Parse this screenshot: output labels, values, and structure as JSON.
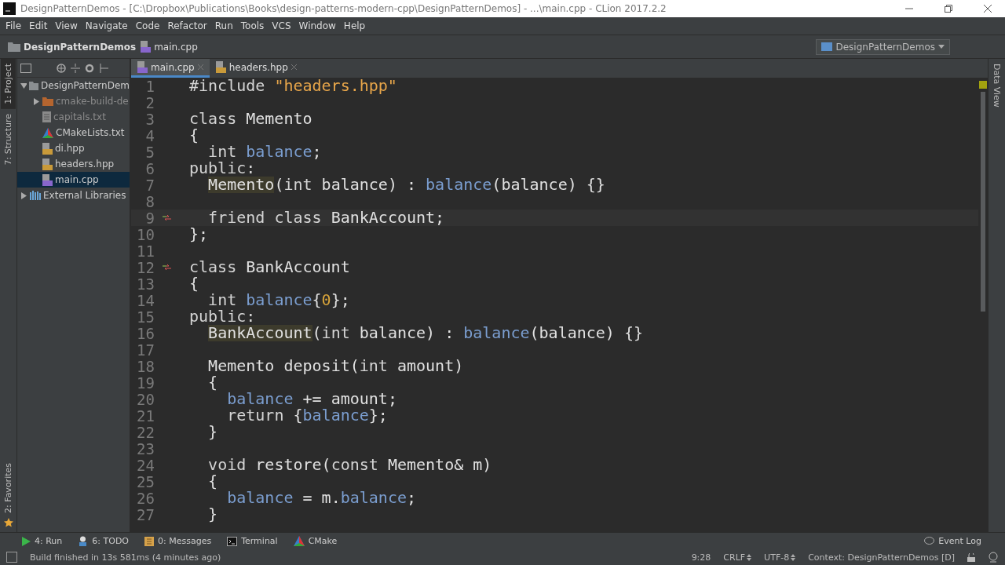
{
  "window": {
    "title": "DesignPatternDemos - [C:\\Dropbox\\Publications\\Books\\design-patterns-modern-cpp\\DesignPatternDemos] - ...\\main.cpp - CLion 2017.2.2"
  },
  "menu": [
    "File",
    "Edit",
    "View",
    "Navigate",
    "Code",
    "Refactor",
    "Run",
    "Tools",
    "VCS",
    "Window",
    "Help"
  ],
  "breadcrumbs": [
    "DesignPatternDemos",
    "main.cpp"
  ],
  "run_config": "DesignPatternDemos",
  "left_stripe": [
    {
      "label": "1: Project",
      "selected": true
    },
    {
      "label": "7: Structure",
      "selected": false
    }
  ],
  "favorites": "2: Favorites",
  "right_stripe": "Data View",
  "tree": [
    {
      "label": "DesignPatternDem",
      "kind": "project",
      "expanded": true,
      "selected": false,
      "children": [
        {
          "label": "cmake-build-de",
          "kind": "folder",
          "expanded": false,
          "selected": false
        },
        {
          "label": "capitals.txt",
          "kind": "text",
          "selected": false
        },
        {
          "label": "CMakeLists.txt",
          "kind": "cmake",
          "selected": false
        },
        {
          "label": "di.hpp",
          "kind": "header",
          "selected": false
        },
        {
          "label": "headers.hpp",
          "kind": "header",
          "selected": false
        },
        {
          "label": "main.cpp",
          "kind": "source",
          "selected": true
        }
      ]
    },
    {
      "label": "External Libraries",
      "kind": "library",
      "expanded": false,
      "selected": false
    }
  ],
  "tabs": [
    {
      "label": "main.cpp",
      "kind": "source",
      "selected": true
    },
    {
      "label": "headers.hpp",
      "kind": "header",
      "selected": false
    }
  ],
  "code": [
    {
      "num": "1",
      "current": false,
      "override": false,
      "tokens": [
        {
          "t": "#include ",
          "kind": "kw"
        },
        {
          "t": "\"headers.hpp\"",
          "kind": "str"
        }
      ]
    },
    {
      "num": "2",
      "current": false,
      "override": false
    },
    {
      "num": "3",
      "current": false,
      "override": false,
      "tokens": [
        {
          "t": "class ",
          "kind": "kw"
        },
        {
          "t": "Memento",
          "kind": "plain"
        }
      ]
    },
    {
      "num": "4",
      "current": false,
      "override": false,
      "tokens": [
        {
          "t": "{",
          "kind": "plain"
        }
      ]
    },
    {
      "num": "5",
      "current": false,
      "override": false,
      "tokens": [
        {
          "t": "  int ",
          "kind": "kw"
        },
        {
          "t": "balance",
          "kind": "field"
        },
        {
          "t": ";",
          "kind": "plain"
        }
      ]
    },
    {
      "num": "6",
      "current": false,
      "override": false,
      "tokens": [
        {
          "t": "public:",
          "kind": "kw"
        }
      ]
    },
    {
      "num": "7",
      "current": false,
      "override": false,
      "tokens": [
        {
          "t": "  Memento",
          "kind": "decl"
        },
        {
          "t": "(",
          "kind": "plain"
        },
        {
          "t": "int ",
          "kind": "kw"
        },
        {
          "t": "balance) : ",
          "kind": "plain"
        },
        {
          "t": "balance",
          "kind": "field"
        },
        {
          "t": "(balance) {}",
          "kind": "plain"
        }
      ]
    },
    {
      "num": "8",
      "current": false,
      "override": false
    },
    {
      "num": "9",
      "current": true,
      "override": true,
      "tokens": [
        {
          "t": "  friend class ",
          "kind": "kw"
        },
        {
          "t": "BankAccount;",
          "kind": "plain"
        }
      ]
    },
    {
      "num": "10",
      "current": false,
      "override": false,
      "tokens": [
        {
          "t": "};",
          "kind": "plain"
        }
      ]
    },
    {
      "num": "11",
      "current": false,
      "override": false
    },
    {
      "num": "12",
      "current": false,
      "override": true,
      "tokens": [
        {
          "t": "class ",
          "kind": "kw"
        },
        {
          "t": "BankAccount",
          "kind": "plain"
        }
      ]
    },
    {
      "num": "13",
      "current": false,
      "override": false,
      "tokens": [
        {
          "t": "{",
          "kind": "plain"
        }
      ]
    },
    {
      "num": "14",
      "current": false,
      "override": false,
      "tokens": [
        {
          "t": "  int ",
          "kind": "kw"
        },
        {
          "t": "balance",
          "kind": "field"
        },
        {
          "t": "{",
          "kind": "plain"
        },
        {
          "t": "0",
          "kind": "num"
        },
        {
          "t": "};",
          "kind": "plain"
        }
      ]
    },
    {
      "num": "15",
      "current": false,
      "override": false,
      "tokens": [
        {
          "t": "public:",
          "kind": "kw"
        }
      ]
    },
    {
      "num": "16",
      "current": false,
      "override": false,
      "tokens": [
        {
          "t": "  BankAccount",
          "kind": "decl"
        },
        {
          "t": "(",
          "kind": "plain"
        },
        {
          "t": "int ",
          "kind": "kw"
        },
        {
          "t": "balance) : ",
          "kind": "plain"
        },
        {
          "t": "balance",
          "kind": "field"
        },
        {
          "t": "(balance) {}",
          "kind": "plain"
        }
      ]
    },
    {
      "num": "17",
      "current": false,
      "override": false
    },
    {
      "num": "18",
      "current": false,
      "override": false,
      "tokens": [
        {
          "t": "  Memento deposit(",
          "kind": "plain"
        },
        {
          "t": "int ",
          "kind": "kw"
        },
        {
          "t": "amount)",
          "kind": "plain"
        }
      ]
    },
    {
      "num": "19",
      "current": false,
      "override": false,
      "tokens": [
        {
          "t": "  {",
          "kind": "plain"
        }
      ]
    },
    {
      "num": "20",
      "current": false,
      "override": false,
      "tokens": [
        {
          "t": "    balance",
          "kind": "field"
        },
        {
          "t": " += amount;",
          "kind": "plain"
        }
      ]
    },
    {
      "num": "21",
      "current": false,
      "override": false,
      "tokens": [
        {
          "t": "    return ",
          "kind": "kw"
        },
        {
          "t": "{",
          "kind": "plain"
        },
        {
          "t": "balance",
          "kind": "field"
        },
        {
          "t": "};",
          "kind": "plain"
        }
      ]
    },
    {
      "num": "22",
      "current": false,
      "override": false,
      "tokens": [
        {
          "t": "  }",
          "kind": "plain"
        }
      ]
    },
    {
      "num": "23",
      "current": false,
      "override": false
    },
    {
      "num": "24",
      "current": false,
      "override": false,
      "tokens": [
        {
          "t": "  void ",
          "kind": "kw"
        },
        {
          "t": "restore(",
          "kind": "plain"
        },
        {
          "t": "const ",
          "kind": "kw"
        },
        {
          "t": "Memento& m)",
          "kind": "plain"
        }
      ]
    },
    {
      "num": "25",
      "current": false,
      "override": false,
      "tokens": [
        {
          "t": "  {",
          "kind": "plain"
        }
      ]
    },
    {
      "num": "26",
      "current": false,
      "override": false,
      "tokens": [
        {
          "t": "    balance",
          "kind": "field"
        },
        {
          "t": " = m.",
          "kind": "plain"
        },
        {
          "t": "balance",
          "kind": "field"
        },
        {
          "t": ";",
          "kind": "plain"
        }
      ]
    },
    {
      "num": "27",
      "current": false,
      "override": false,
      "tokens": [
        {
          "t": "  }",
          "kind": "plain"
        }
      ]
    }
  ],
  "tool_windows": [
    {
      "label": "4: Run",
      "kind": "run"
    },
    {
      "label": "6: TODO",
      "kind": "todo"
    },
    {
      "label": "0: Messages",
      "kind": "messages"
    },
    {
      "label": "Terminal",
      "kind": "terminal"
    },
    {
      "label": "CMake",
      "kind": "cmake"
    }
  ],
  "event_log": "Event Log",
  "status_bar": {
    "message": "Build finished in 13s 581ms (4 minutes ago)",
    "position": "9:28",
    "line_separator": "CRLF",
    "encoding": "UTF-8",
    "context": "Context: DesignPatternDemos [D]"
  }
}
